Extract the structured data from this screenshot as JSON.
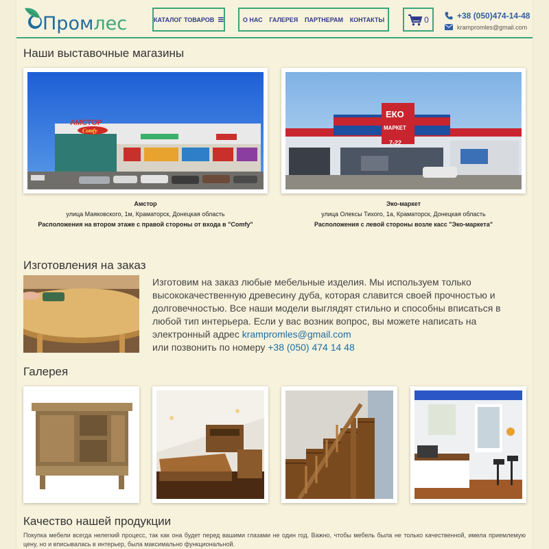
{
  "header": {
    "logo": {
      "part1": "Пром",
      "part2": "лес"
    },
    "catalog_label": "КАТАЛОГ ТОВАРОВ",
    "nav": [
      "О НАС",
      "ГАЛЕРЕЯ",
      "ПАРТНЕРАМ",
      "КОНТАКТЫ"
    ],
    "cart_count": "0",
    "phone": "+38 (050)474-14-48",
    "email": "krampromles@gmail.com"
  },
  "stores": {
    "title": "Наши выставочные магазины",
    "items": [
      {
        "name": "Амстор",
        "address": "улица Маяковского, 1м, Краматорск, Донецкая область",
        "note": "Расположения на втором этаже с правой стороны от входа в \"Comfy\"",
        "sign_top": "АМСТОР",
        "sign_bottom": "Comfy"
      },
      {
        "name": "Эко-маркет",
        "address": "улица  Олексы Тихого, 1а, Краматорск, Донецкая область",
        "note": "Расположения с левой стороны возле касс \"Эко-маркета\"",
        "sign_top": "ЕКО",
        "sign_mid": "МАРКЕТ",
        "sign_hours": "7-22"
      }
    ]
  },
  "order": {
    "title": "Изготовления на заказ",
    "text": "Изготовим на заказ любые мебельные изделия. Мы используем только высококачественную древесину дуба, которая славится своей прочностью и долговечностью. Все наши модели выглядят стильно и способны вписаться в любой тип интерьера. Если у вас возник вопрос, вы можете написать на электронный адрес ",
    "email": "krampromles@gmail.com",
    "phone_prefix": "или позвонить по номеру ",
    "phone": "+38 (050) 474 14 48"
  },
  "gallery": {
    "title": "Галерея",
    "items": [
      "tv-cabinet",
      "bedroom",
      "staircase",
      "kitchen"
    ]
  },
  "quality": {
    "title": "Качество нашей продукции",
    "text": "Покупка мебели всегда нелегкий процесс, так как она будет перед вашими глазами не один год. Важно, чтобы мебель была не только качественной, имела приемлемую цену, но и вписывалась в интерьер, была максимально функциональной."
  },
  "colors": {
    "accent": "#3aa67a",
    "nav_text": "#2f3a8c",
    "link": "#1e6da0",
    "background": "#f7f2dc"
  }
}
